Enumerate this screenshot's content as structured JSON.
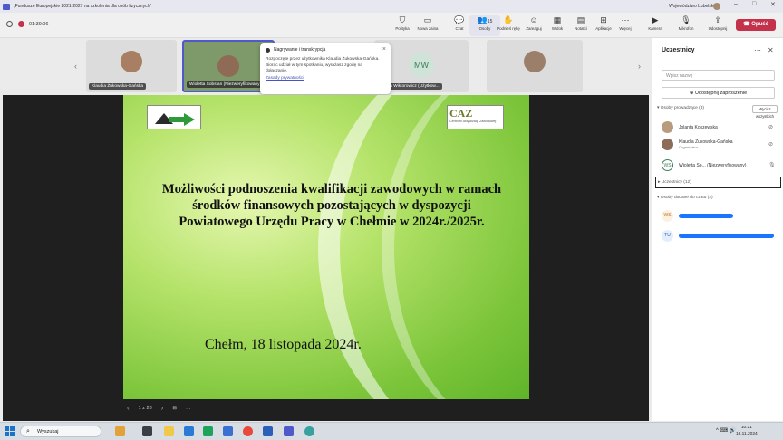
{
  "window": {
    "title": "„Fundusze Europejskie 2021-2027 na szkolenia dla osób fizycznych”",
    "org": "Województwo Lubelskie"
  },
  "toolbar": {
    "timer": "01:39:06",
    "items": [
      "Polityka",
      "Nowa zaina",
      "Czat",
      "Osoby",
      "Podnieś rękę",
      "Zareaguj",
      "Widok",
      "Notatki",
      "Aplikacje",
      "Więcej",
      "Kamera",
      "Mikrofon",
      "Udostępnij"
    ],
    "people_count": "15",
    "leave_label": "Opuść"
  },
  "strip": {
    "tiles": [
      {
        "name": "Klaudia Żukowska-Gańska"
      },
      {
        "name": "Wioletta Sobstan (Niezweryfikowany)"
      },
      {
        "name": "",
        "initials": "MW"
      },
      {
        "name": "Sylwia Wiktorowicz (Użytkow..."
      },
      {
        "name": ""
      }
    ]
  },
  "toast": {
    "heading": "Nagrywanie i transkrypcja",
    "body": "Rozpoczęte przez użytkownika Klaudia Żukowska-Gańska. Biorąc udział w tym spotkaniu, wyrażasz zgodę na dołączanie.",
    "link": "Zasady prywatności"
  },
  "slide": {
    "logo2_text": "CAZ",
    "logo2_small": "Centrum Aktywizacji Zawodowej",
    "title": "Możliwości podnoszenia kwalifikacji zawodowych w ramach środków finansowych pozostających w dyspozycji Powiatowego Urzędu Pracy w Chełmie w 2024r./2025r.",
    "date_line": "Chełm, 18 listopada 2024r."
  },
  "pager": {
    "page": "1 z 28",
    "more": "…"
  },
  "panel": {
    "title": "Uczestnicy",
    "search_placeholder": "Wpisz nazwę",
    "share_label": "Udostępnij zaproszenie",
    "presenters_label": "Osoby prowadzące (3)",
    "mute_all_label": "Wycisz wszystkich",
    "presenters": [
      {
        "name": "Jolanta Koszewska",
        "role": ""
      },
      {
        "name": "Klaudia Żukowska-Gańska",
        "role": "Organizator"
      },
      {
        "name": "Wioletta So... (Niezweryfikowany)",
        "role": "",
        "initials": "WS"
      }
    ],
    "attendees_label": "Uczestnicy (12)",
    "chat_label": "Osoby dodane do czatu (2)",
    "chat_people": [
      {
        "initials": "WS"
      },
      {
        "initials": "TU"
      }
    ]
  },
  "taskbar": {
    "search_label": "Wyszukaj",
    "time": "10:21",
    "date": "18.11.2024"
  },
  "colors": {
    "accent": "#5059c9",
    "leave": "#c4314b",
    "slide_green": "#7cc53a"
  }
}
